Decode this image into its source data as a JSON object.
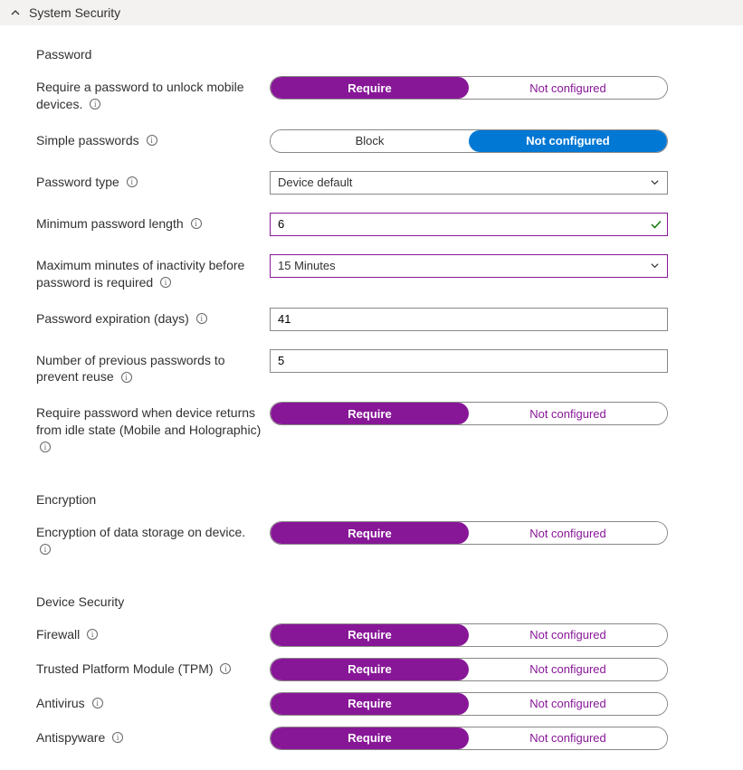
{
  "header": {
    "title": "System Security"
  },
  "sections": {
    "password": {
      "title": "Password",
      "requireUnlock": {
        "label": "Require a password to unlock mobile devices.",
        "opt1": "Require",
        "opt2": "Not configured",
        "selected": 0
      },
      "simple": {
        "label": "Simple passwords",
        "opt1": "Block",
        "opt2": "Not configured",
        "selected": 1
      },
      "type": {
        "label": "Password type",
        "value": "Device default"
      },
      "minLength": {
        "label": "Minimum password length",
        "value": "6"
      },
      "maxInactivity": {
        "label": "Maximum minutes of inactivity before password is required",
        "value": "15 Minutes"
      },
      "expiration": {
        "label": "Password expiration (days)",
        "value": "41"
      },
      "history": {
        "label": "Number of previous passwords to prevent reuse",
        "value": "5"
      },
      "idleReturn": {
        "label": "Require password when device returns from idle state (Mobile and Holographic)",
        "opt1": "Require",
        "opt2": "Not configured",
        "selected": 0
      }
    },
    "encryption": {
      "title": "Encryption",
      "storage": {
        "label": "Encryption of data storage on device.",
        "opt1": "Require",
        "opt2": "Not configured",
        "selected": 0
      }
    },
    "deviceSecurity": {
      "title": "Device Security",
      "firewall": {
        "label": "Firewall",
        "opt1": "Require",
        "opt2": "Not configured",
        "selected": 0
      },
      "tpm": {
        "label": "Trusted Platform Module (TPM)",
        "opt1": "Require",
        "opt2": "Not configured",
        "selected": 0
      },
      "antivirus": {
        "label": "Antivirus",
        "opt1": "Require",
        "opt2": "Not configured",
        "selected": 0
      },
      "antispyware": {
        "label": "Antispyware",
        "opt1": "Require",
        "opt2": "Not configured",
        "selected": 0
      }
    }
  }
}
